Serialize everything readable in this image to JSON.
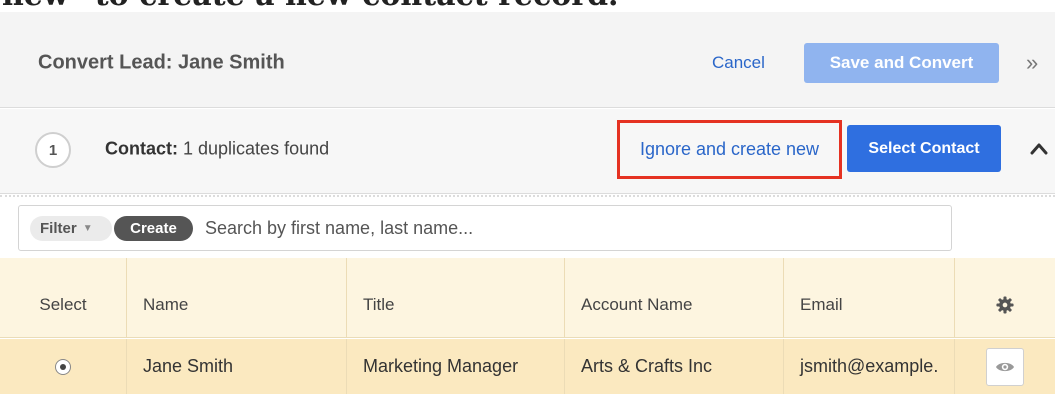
{
  "caption": "new\" to create a new contact record.",
  "header": {
    "title": "Convert Lead: Jane Smith",
    "cancel_label": "Cancel",
    "save_convert_label": "Save and Convert",
    "collapse_glyph": "»"
  },
  "section": {
    "step": "1",
    "label_bold": "Contact:",
    "label_rest": " 1 duplicates found",
    "ignore_label": "Ignore and create new",
    "select_label": "Select Contact"
  },
  "filter": {
    "filter_label": "Filter",
    "create_label": "Create",
    "search_placeholder": "Search by first name, last name..."
  },
  "table": {
    "columns": [
      "Select",
      "Name",
      "Title",
      "Account Name",
      "Email"
    ],
    "rows": [
      {
        "selected": true,
        "name": "Jane Smith",
        "title": "Marketing Manager",
        "account": "Arts & Crafts Inc",
        "email": "jsmith@example."
      }
    ]
  },
  "colors": {
    "highlight_border": "#e53222",
    "primary_button": "#2f6fe0",
    "disabled_button": "#90b4ef",
    "link": "#2a66c9"
  },
  "icons": [
    "double-chevron-right-icon",
    "chevron-up-icon",
    "caret-down-icon",
    "gear-icon",
    "eye-icon",
    "radio-selected-icon"
  ]
}
